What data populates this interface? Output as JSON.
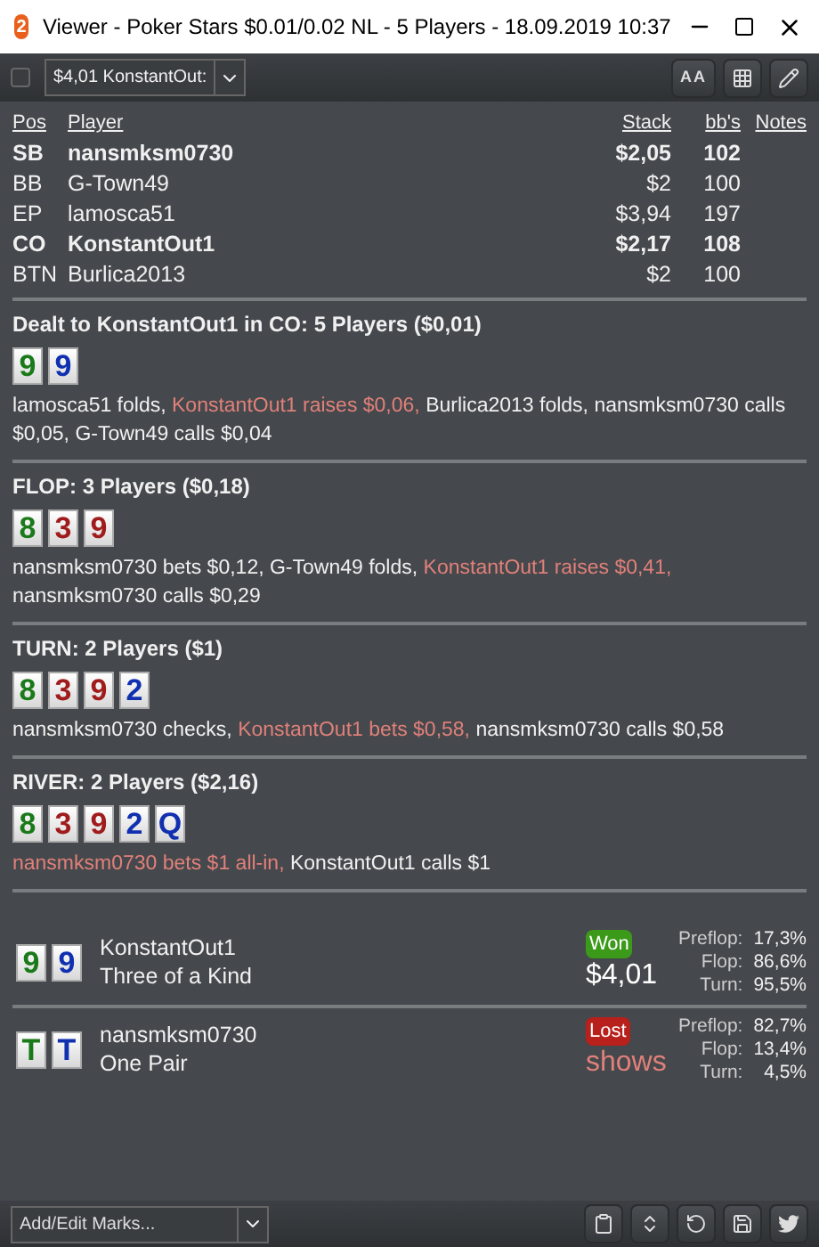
{
  "window": {
    "logo_text": "2",
    "title": "Viewer - Poker Stars $0.01/0.02 NL - 5 Players - 18.09.2019 10:37"
  },
  "toolbar": {
    "checkbox": {
      "checked": false
    },
    "hand_select": {
      "value": "$4,01 KonstantOut:"
    },
    "font_button": {
      "label": "AA"
    }
  },
  "players_table": {
    "columns": [
      "Pos",
      "Player",
      "Stack",
      "bb's",
      "Notes"
    ],
    "rows": [
      {
        "pos": "SB",
        "player": "nansmksm0730",
        "stack": "$2,05",
        "bbs": "102",
        "highlighted": true
      },
      {
        "pos": "BB",
        "player": "G-Town49",
        "stack": "$2",
        "bbs": "100",
        "highlighted": false
      },
      {
        "pos": "EP",
        "player": "lamosca51",
        "stack": "$3,94",
        "bbs": "197",
        "highlighted": false
      },
      {
        "pos": "CO",
        "player": "KonstantOut1",
        "stack": "$2,17",
        "bbs": "108",
        "highlighted": true
      },
      {
        "pos": "BTN",
        "player": "Burlica2013",
        "stack": "$2",
        "bbs": "100",
        "highlighted": false
      }
    ]
  },
  "streets": [
    {
      "title": "Dealt to KonstantOut1 in CO: 5 Players ($0,01)",
      "cards": [
        {
          "rank": "9",
          "color": "#1a7a1a"
        },
        {
          "rank": "9",
          "color": "#1030b0"
        }
      ],
      "actions": [
        {
          "text": "lamosca51 folds,",
          "highlighted": false
        },
        {
          "text": "KonstantOut1 raises $0,06,",
          "highlighted": true
        },
        {
          "text": "Burlica2013 folds,",
          "highlighted": false
        },
        {
          "text": "nansmksm0730 calls $0,05,",
          "highlighted": false
        },
        {
          "text": "G-Town49 calls $0,04",
          "highlighted": false
        }
      ]
    },
    {
      "title": "FLOP: 3 Players ($0,18)",
      "cards": [
        {
          "rank": "8",
          "color": "#1a7a1a"
        },
        {
          "rank": "3",
          "color": "#a01c1c"
        },
        {
          "rank": "9",
          "color": "#a01c1c"
        }
      ],
      "actions": [
        {
          "text": "nansmksm0730 bets $0,12,",
          "highlighted": false
        },
        {
          "text": "G-Town49 folds,",
          "highlighted": false
        },
        {
          "text": "KonstantOut1 raises $0,41,",
          "highlighted": true
        },
        {
          "text": "nansmksm0730 calls $0,29",
          "highlighted": false
        }
      ]
    },
    {
      "title": "TURN: 2 Players ($1)",
      "cards": [
        {
          "rank": "8",
          "color": "#1a7a1a"
        },
        {
          "rank": "3",
          "color": "#a01c1c"
        },
        {
          "rank": "9",
          "color": "#a01c1c"
        },
        {
          "rank": "2",
          "color": "#1030b0"
        }
      ],
      "actions": [
        {
          "text": "nansmksm0730 checks,",
          "highlighted": false
        },
        {
          "text": "KonstantOut1 bets $0,58,",
          "highlighted": true
        },
        {
          "text": "nansmksm0730 calls $0,58",
          "highlighted": false
        }
      ]
    },
    {
      "title": "RIVER: 2 Players ($2,16)",
      "cards": [
        {
          "rank": "8",
          "color": "#1a7a1a"
        },
        {
          "rank": "3",
          "color": "#a01c1c"
        },
        {
          "rank": "9",
          "color": "#a01c1c"
        },
        {
          "rank": "2",
          "color": "#1030b0"
        },
        {
          "rank": "Q",
          "color": "#1030b0"
        }
      ],
      "actions": [
        {
          "text": "nansmksm0730 bets $1 all-in,",
          "highlighted": true
        },
        {
          "text": "KonstantOut1 calls $1",
          "highlighted": false
        }
      ]
    }
  ],
  "results": [
    {
      "cards": [
        {
          "rank": "9",
          "color": "#1a7a1a"
        },
        {
          "rank": "9",
          "color": "#1030b0"
        }
      ],
      "player": "KonstantOut1",
      "hand": "Three of a Kind",
      "outcome": {
        "kind": "won",
        "label": "Won"
      },
      "amount": "$4,01",
      "equity": [
        {
          "label": "Preflop:",
          "value": "17,3%"
        },
        {
          "label": "Flop:",
          "value": "86,6%"
        },
        {
          "label": "Turn:",
          "value": "95,5%"
        }
      ]
    },
    {
      "cards": [
        {
          "rank": "T",
          "color": "#1a7a1a"
        },
        {
          "rank": "T",
          "color": "#1030b0"
        }
      ],
      "player": "nansmksm0730",
      "hand": "One Pair",
      "outcome": {
        "kind": "lost",
        "label": "Lost"
      },
      "amount": "shows",
      "equity": [
        {
          "label": "Preflop:",
          "value": "82,7%"
        },
        {
          "label": "Flop:",
          "value": "13,4%"
        },
        {
          "label": "Turn:",
          "value": "4,5%"
        }
      ]
    }
  ],
  "bottom_bar": {
    "marks_select": {
      "placeholder": "Add/Edit Marks..."
    }
  }
}
